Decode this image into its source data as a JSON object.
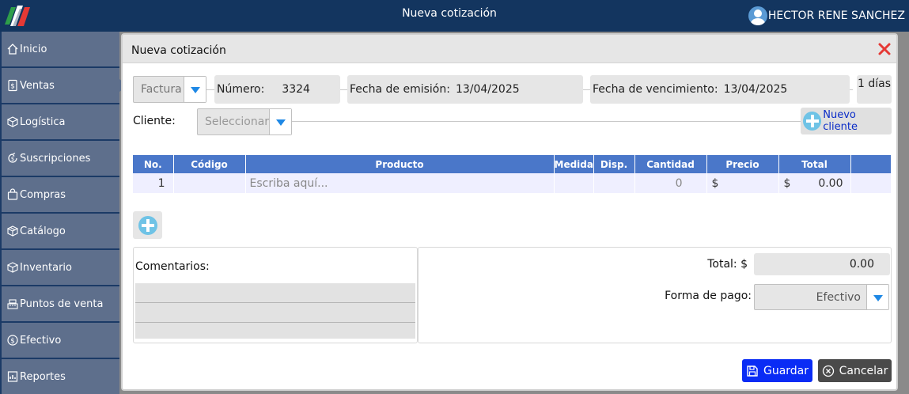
{
  "app": {
    "title": "Nueva cotización",
    "user_name": "HECTOR RENE SANCHEZ"
  },
  "colors": {
    "topbar": "#13355f",
    "sidebar_item": "#5e6f8c",
    "table_header": "#4a77c9",
    "save_button": "#0a2cf5",
    "cancel_button": "#4a4a4a",
    "close_icon": "#e53935",
    "plus_icon": "#6fc3e6"
  },
  "sidebar": {
    "items": [
      {
        "label": "Inicio",
        "icon": "home-icon"
      },
      {
        "label": "Ventas",
        "icon": "sales-receipt-icon",
        "active": true
      },
      {
        "label": "Logística",
        "icon": "logistics-box-icon"
      },
      {
        "label": "Suscripciones",
        "icon": "subscriptions-icon"
      },
      {
        "label": "Compras",
        "icon": "shopping-bag-icon"
      },
      {
        "label": "Catálogo",
        "icon": "catalog-box-icon"
      },
      {
        "label": "Inventario",
        "icon": "inventory-box-icon"
      },
      {
        "label": "Puntos de venta",
        "icon": "cash-register-icon"
      },
      {
        "label": "Efectivo",
        "icon": "cash-coin-icon"
      },
      {
        "label": "Reportes",
        "icon": "reports-icon"
      }
    ]
  },
  "modal": {
    "title": "Nueva cotización",
    "doc_type": "Factura",
    "numero_label": "Número:",
    "numero_value": "3324",
    "emision_label": "Fecha de emisión:",
    "emision_value": "13/04/2025",
    "vencimiento_label": "Fecha de vencimiento:",
    "vencimiento_value": "13/04/2025",
    "dias": "1 días",
    "cliente_label": "Cliente:",
    "cliente_placeholder": "Seleccionar",
    "nuevo_cliente_label": "Nuevo cliente"
  },
  "table": {
    "headers": [
      "No.",
      "Código",
      "Producto",
      "Medida",
      "Disp.",
      "Cantidad",
      "Precio",
      "Total",
      ""
    ],
    "row": {
      "no": "1",
      "codigo": "",
      "producto_placeholder": "Escriba aquí...",
      "medida": "",
      "disp": "",
      "cantidad": "0",
      "precio_currency": "$",
      "precio": "",
      "total_currency": "$",
      "total": "0.00"
    }
  },
  "footer": {
    "comentarios_label": "Comentarios:",
    "total_label": "Total: $",
    "total_value": "0.00",
    "forma_pago_label": "Forma de pago:",
    "forma_pago_value": "Efectivo",
    "save_label": "Guardar",
    "cancel_label": "Cancelar"
  }
}
